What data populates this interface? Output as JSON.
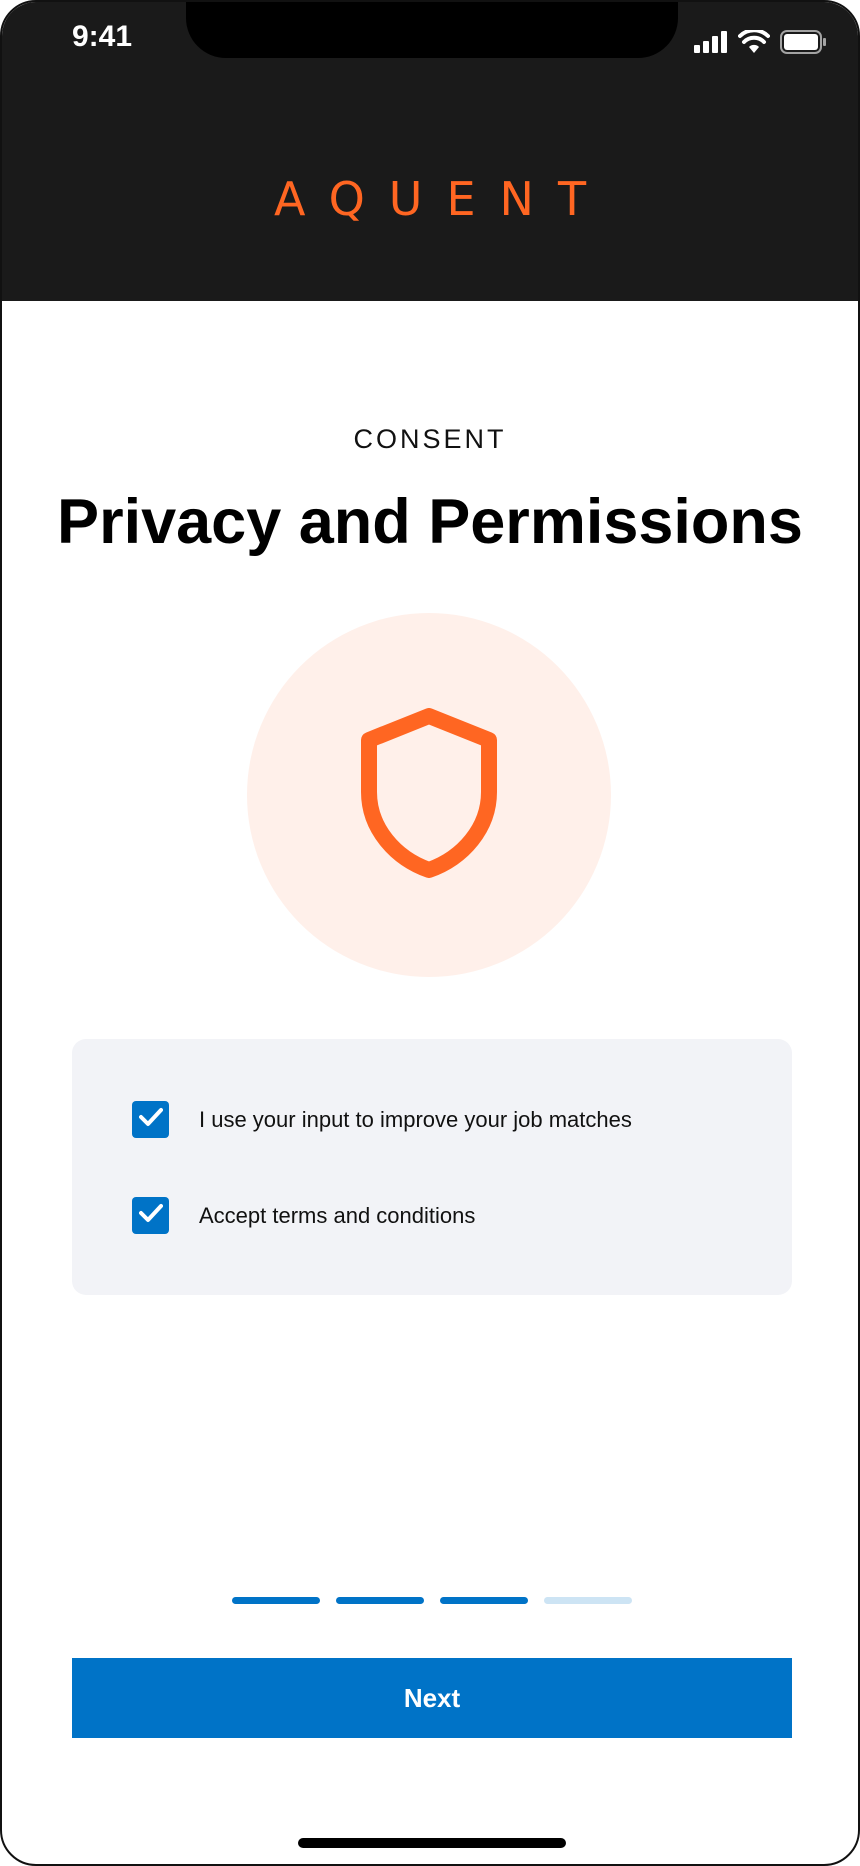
{
  "status_bar": {
    "time": "9:41",
    "icons": [
      "cellular-signal-icon",
      "wifi-icon",
      "battery-icon"
    ]
  },
  "brand": {
    "logo_text": "AQUENT",
    "color": "#FF6622"
  },
  "header": {
    "eyebrow": "CONSENT",
    "title": "Privacy and Permissions"
  },
  "hero": {
    "icon": "shield-icon",
    "circle_color": "#FFF0EA"
  },
  "consents": [
    {
      "label": "I use your input to improve your job matches",
      "checked": true
    },
    {
      "label": "Accept terms and conditions",
      "checked": true
    }
  ],
  "progress": {
    "current_step": 3,
    "total_steps": 4
  },
  "actions": {
    "next_label": "Next"
  },
  "colors": {
    "accent": "#0073C7",
    "header_background": "#1A1A1A",
    "card_background": "#F2F3F7",
    "progress_pending": "#CDE4F4"
  }
}
